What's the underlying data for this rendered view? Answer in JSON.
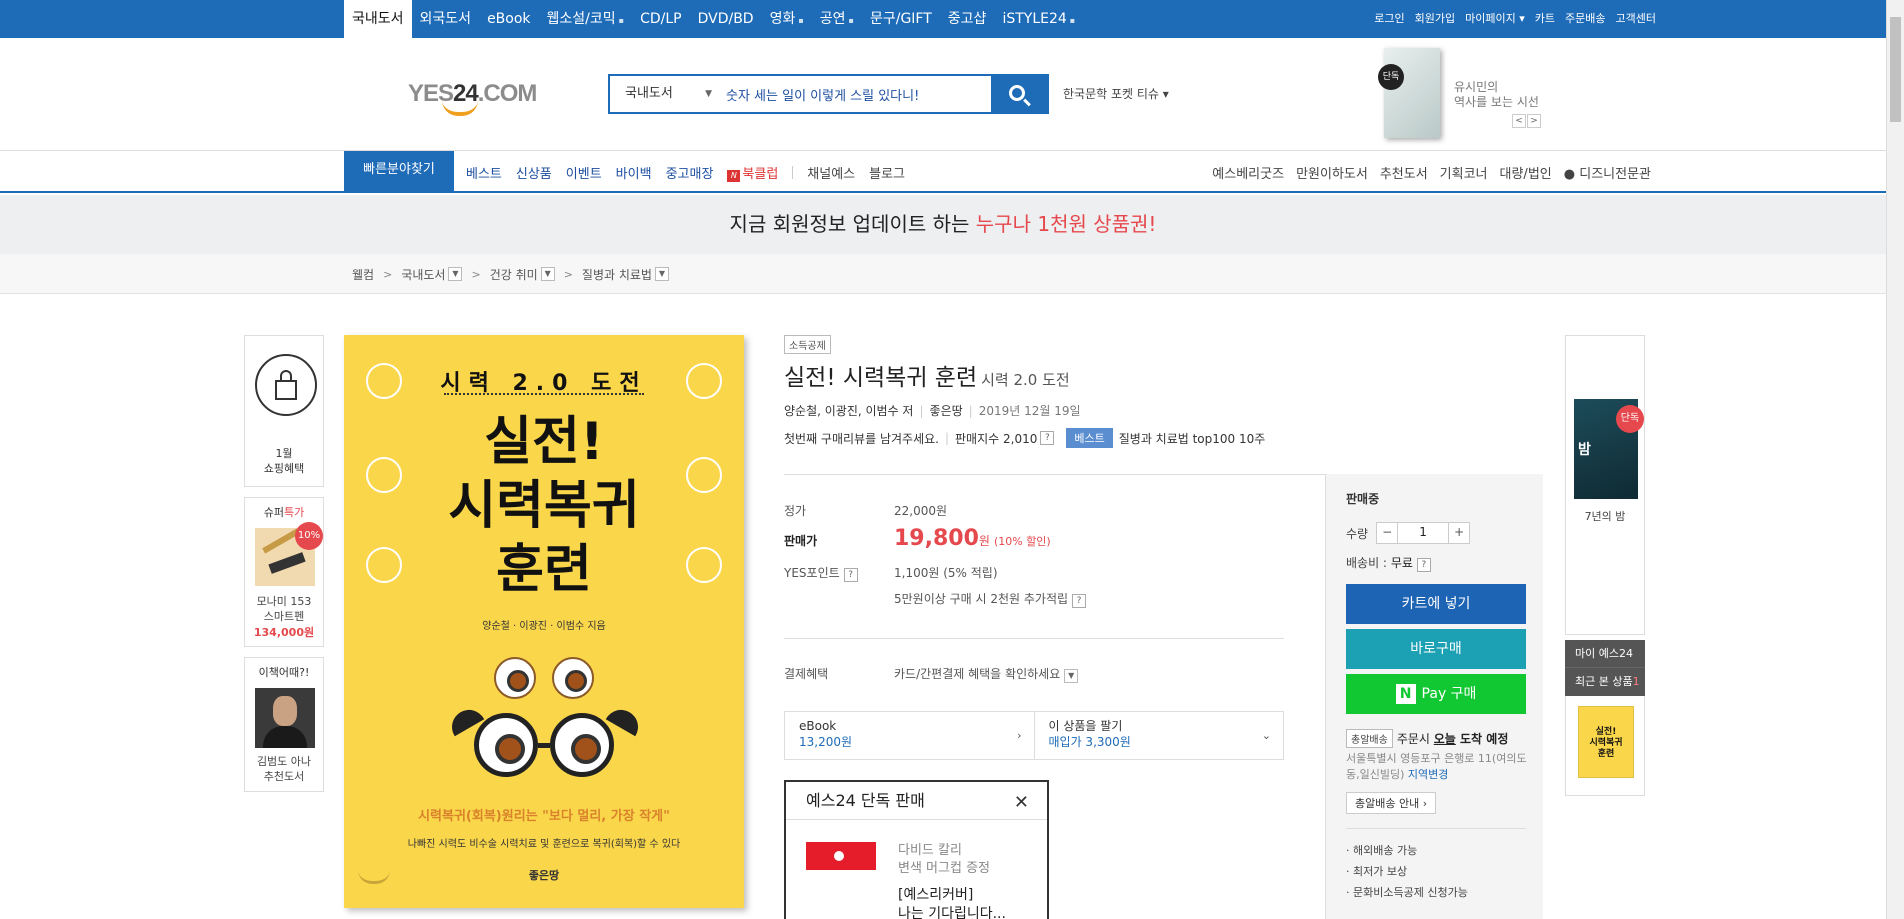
{
  "topbar": {
    "categories": [
      "국내도서",
      "외국도서",
      "eBook",
      "웹소설/코믹",
      "CD/LP",
      "DVD/BD",
      "영화",
      "공연",
      "문구/GIFT",
      "중고샵",
      "iSTYLE24"
    ],
    "util": [
      "로그인",
      "회원가입",
      "마이페이지 ▾",
      "카트",
      "주문배송",
      "고객센터"
    ]
  },
  "logo": {
    "text_a": "YES",
    "text_b": "24",
    "text_c": ".COM"
  },
  "search": {
    "category": "국내도서",
    "query": "숫자 세는 일이 이렇게 스릴 있다니!"
  },
  "keyword": "한국문학 포켓 티슈 ▾",
  "ad": {
    "badge": "단독",
    "text": "유시민의\n역사를 보는 시선",
    "prev": "<",
    "next": ">"
  },
  "nav": {
    "quick": "빠른분야찾기",
    "left_blue": [
      "베스트",
      "신상품",
      "이벤트",
      "바이백",
      "중고매장"
    ],
    "bookclub": "북클럽",
    "bookclub_badge": "N",
    "left_gray": [
      "채널예스",
      "블로그"
    ],
    "right": [
      "예스베리굿즈",
      "만원이하도서",
      "추천도서",
      "기획코너",
      "대량/법인",
      "디즈니전문관"
    ]
  },
  "banner": {
    "prefix": "지금 회원정보 업데이트 하는 ",
    "highlight": "누구나 1천원 상품권!"
  },
  "breadcrumb": {
    "home": "웰컴",
    "sep": ">",
    "items": [
      "국내도서",
      "건강 취미",
      "질병과 치료법"
    ]
  },
  "left_side": {
    "shopping": "1월\n쇼핑혜택",
    "super_title_a": "슈퍼",
    "super_title_b": "특가",
    "super_discount": "10%",
    "super_name": "모나미 153\n스마트펜",
    "super_price": "134,000원",
    "reco_title": "이책어때?!",
    "reco_name": "김범도 아나\n추천도서"
  },
  "cover": {
    "top": "시력 2.0 도전",
    "big": "실전!\n시력복귀\n훈련",
    "authors": "양순철 · 이광진 · 이범수 지음",
    "tag1": "시력복귀(회복)원리는 \"보다 멀리, 가장 작게\"",
    "tag2": "나빠진 시력도 비수술 시력치료 및 훈련으로 복귀(회복)할 수 있다",
    "publisher": "좋은땅"
  },
  "product": {
    "tag": "소득공제",
    "title": "실전! 시력복귀 훈련",
    "subtitle": "시력 2.0 도전",
    "authors": "양순철, 이광진, 이범수 저",
    "publisher": "좋은땅",
    "date": "2019년 12월 19일",
    "review": "첫번째 구매리뷰를 남겨주세요.",
    "sales_index": "판매지수 2,010",
    "best_label": "베스트",
    "best_text": "질병과 치료법 top100 10주",
    "help": "?"
  },
  "price": {
    "list_label": "정가",
    "list_value": "22,000원",
    "sale_label": "판매가",
    "sale_value": "19,800",
    "sale_unit": "원",
    "sale_discount": "(10% 할인)",
    "point_label": "YES포인트",
    "point_value": "1,100원 (5% 적립)",
    "point_extra": "5만원이상 구매 시 2천원 추가적립",
    "benefit_label": "결제혜택",
    "benefit_value": "카드/간편결제 혜택을 확인하세요"
  },
  "options": {
    "ebook_label": "eBook",
    "ebook_price": "13,200원",
    "sell_label": "이 상품을 팔기",
    "sell_price": "매입가 3,300원"
  },
  "exclusive": {
    "title": "예스24 단독 판매",
    "close": "✕",
    "line1": "다비드 칼리\n변색 머그컵 증정",
    "line2": "[예스리커버]\n나는 기다립니다..."
  },
  "panel": {
    "status": "판매중",
    "qty_label": "수량",
    "qty_minus": "−",
    "qty_value": "1",
    "qty_plus": "+",
    "ship_label": "배송비 :",
    "ship_value": "무료",
    "cart": "카트에 넣기",
    "buy": "바로구매",
    "npay_logo": "N",
    "npay": "Pay 구매",
    "day_tag": "총알배송",
    "day_text_a": "주문시 ",
    "day_today": "오늘",
    "day_text_b": " 도착 예정",
    "addr": "서울특별시 영등포구 은행로 11(여의도동,일신빌딩)",
    "addr_change": "지역변경",
    "info": "총알배송 안내 ›",
    "bullets": [
      "· 해외배송 가능",
      "· 최저가 보상",
      "· 문화비소득공제 신청가능"
    ]
  },
  "right_side": {
    "book_badge": "단독",
    "book_word": "밤",
    "book_title": "7년의 밤",
    "my": "마이 예스24",
    "recent": "최근 본 상품",
    "recent_count": "1",
    "recent_mini": "실전!\n시력복귀\n훈련"
  }
}
